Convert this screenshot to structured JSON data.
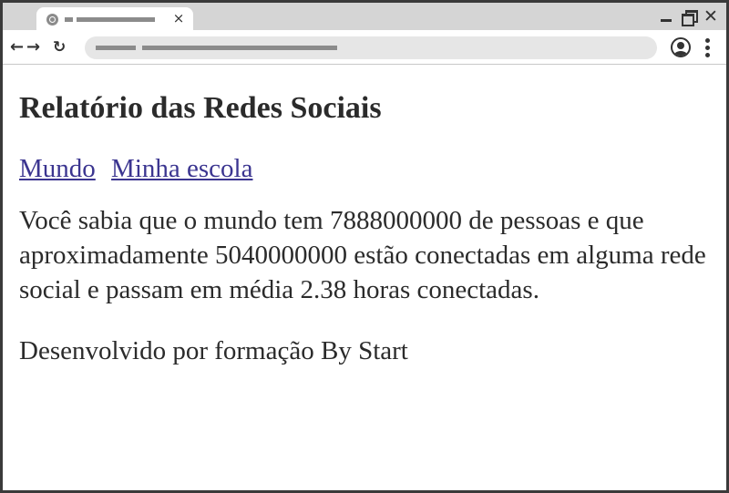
{
  "page": {
    "title": "Relatório das Redes Sociais",
    "nav_links": [
      {
        "label": "Mundo"
      },
      {
        "label": "Minha escola"
      }
    ],
    "intro": {
      "part1": "Você sabia que o mundo tem ",
      "world_population": "7888000000",
      "part2": " de pessoas e que aproximadamente ",
      "connected_people": "5040000000",
      "part3": " estão conectadas em alguma rede social e passam em média ",
      "avg_hours": "2.38",
      "part4": " horas conectadas."
    },
    "footer": "Desenvolvido por formação By Start"
  },
  "browser": {
    "tab_close_glyph": "×",
    "window_close_glyph": "✕",
    "back_glyph": "←",
    "forward_glyph": "→",
    "reload_glyph": "↻",
    "icons": [
      "globe-icon",
      "close-icon",
      "minimize-icon",
      "maximize-icon",
      "back-arrow-icon",
      "forward-arrow-icon",
      "reload-icon",
      "profile-icon",
      "kebab-menu-icon"
    ]
  },
  "colors": {
    "link": "#3b3590",
    "text": "#2b2b2b",
    "chrome": "#d5d5d5",
    "omnibox": "#e6e6e6"
  }
}
